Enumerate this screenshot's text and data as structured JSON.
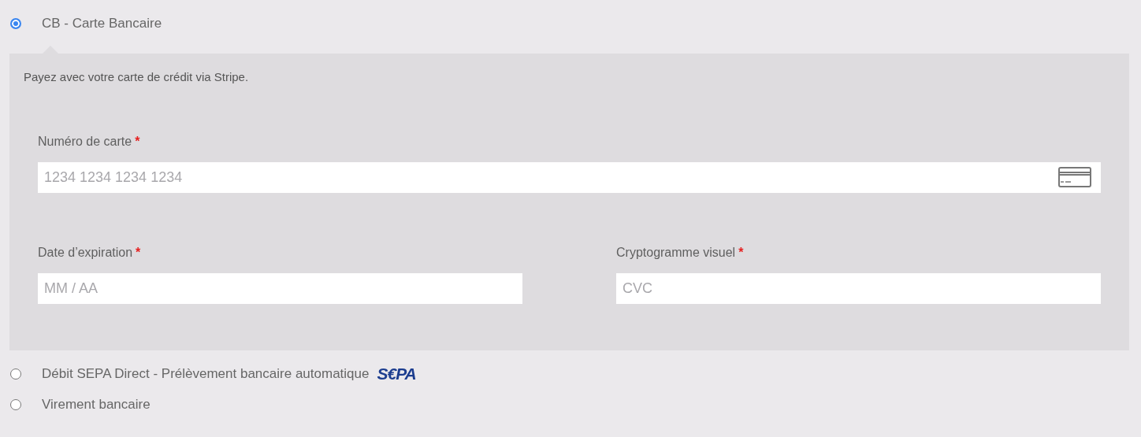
{
  "payment_methods": [
    {
      "label": "CB - Carte Bancaire",
      "selected": true,
      "description": "Payez avec votre carte de crédit via Stripe.",
      "fields": [
        {
          "label": "Numéro de carte",
          "required_mark": "*",
          "placeholder": "1234 1234 1234 1234",
          "kind": "card-number"
        },
        {
          "label": "Date d’expiration",
          "required_mark": "*",
          "placeholder": "MM / AA",
          "kind": "expiry"
        },
        {
          "label": "Cryptogramme visuel",
          "required_mark": "*",
          "placeholder": "CVC",
          "kind": "cvc"
        }
      ]
    },
    {
      "label": "Débit SEPA Direct - Prélèvement bancaire automatique",
      "selected": false,
      "logo": "S€PA"
    },
    {
      "label": "Virement bancaire",
      "selected": false
    }
  ]
}
